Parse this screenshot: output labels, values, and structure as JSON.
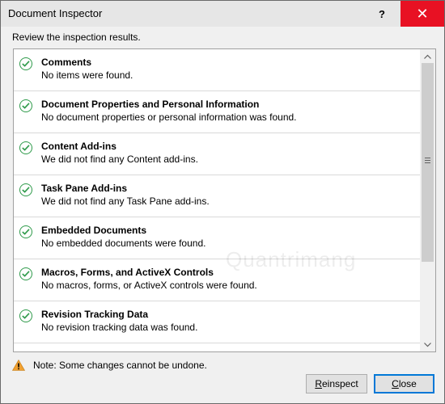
{
  "window": {
    "title": "Document Inspector",
    "help_glyph": "?",
    "close_glyph": "✕"
  },
  "prompt": "Review the inspection results.",
  "results": [
    {
      "title": "Comments",
      "desc": "No items were found."
    },
    {
      "title": "Document Properties and Personal Information",
      "desc": "No document properties or personal information was found."
    },
    {
      "title": "Content Add-ins",
      "desc": "We did not find any Content add-ins."
    },
    {
      "title": "Task Pane Add-ins",
      "desc": "We did not find any Task Pane add-ins."
    },
    {
      "title": "Embedded Documents",
      "desc": "No embedded documents were found."
    },
    {
      "title": "Macros, Forms, and ActiveX Controls",
      "desc": "No macros, forms, or ActiveX controls were found."
    },
    {
      "title": "Revision Tracking Data",
      "desc": "No revision tracking data was found."
    }
  ],
  "footer": {
    "note": "Note: Some changes cannot be undone.",
    "reinspect": {
      "mnemonic": "R",
      "rest": "einspect"
    },
    "close": {
      "mnemonic": "C",
      "rest": "lose"
    }
  },
  "watermark": "Quantrimang",
  "colors": {
    "check": "#2e9a4a",
    "close_hover": "#e81123",
    "warning": "#f0a030",
    "default_button_border": "#0078d7"
  },
  "icons": {
    "status": "check-circle-icon",
    "note": "warning-icon"
  }
}
